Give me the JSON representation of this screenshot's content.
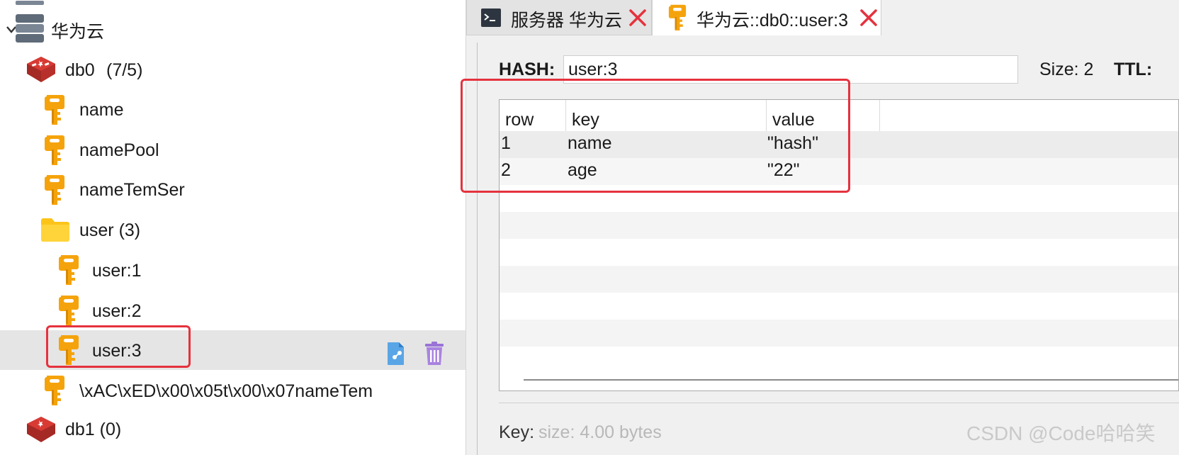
{
  "tree": {
    "connection": "华为云",
    "db0": {
      "name": "db0",
      "count": "(7/5)"
    },
    "keys": [
      "name",
      "namePool",
      "nameTemSer"
    ],
    "folder": "user (3)",
    "user_keys": [
      "user:1",
      "user:2",
      "user:3"
    ],
    "serialized_key": "\\xAC\\xED\\x00\\x05t\\x00\\x07nameTem",
    "db1": "db1 (0)"
  },
  "tabs": [
    {
      "label": "服务器 华为云",
      "icon": "terminal-icon"
    },
    {
      "label": "华为云::db0::user:3",
      "icon": "key-icon"
    }
  ],
  "editor": {
    "type_label": "HASH:",
    "key_name": "user:3",
    "size": "Size: 2",
    "ttl_label": "TTL:"
  },
  "grid": {
    "headers": [
      "row",
      "key",
      "value"
    ],
    "rows": [
      {
        "row": "1",
        "key": "name",
        "value": "\"hash\""
      },
      {
        "row": "2",
        "key": "age",
        "value": "\"22\""
      }
    ]
  },
  "value_panel": {
    "key_label": "Key:",
    "size_hint": "size: 4.00 bytes"
  },
  "watermark": "CSDN @Code哈哈笑",
  "colors": {
    "highlight_red": "#e5323e",
    "key_orange": "#f5a30c",
    "folder_yellow": "#fcc419",
    "redis_red": "#d83a34"
  }
}
